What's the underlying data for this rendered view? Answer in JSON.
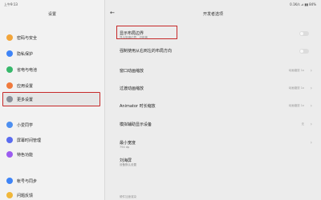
{
  "status": {
    "time": "上午9:13",
    "right": "0.1K/s ⊿ ▮▮ 84%"
  },
  "colors": {
    "highlight_border": "#c62828",
    "toggle_off": "#dcdcdc"
  },
  "left": {
    "title": "设置",
    "items": [
      {
        "label": "密码与安全",
        "icon": "lock-icon",
        "color": "#f2a53a"
      },
      {
        "label": "隐私保护",
        "icon": "privacy-icon",
        "color": "#3e84f7"
      },
      {
        "label": "省电与电池",
        "icon": "battery-icon",
        "color": "#37b86b"
      },
      {
        "label": "应用设置",
        "icon": "apps-icon",
        "color": "#f07a3c"
      },
      {
        "label": "更多设置",
        "icon": "more-settings-icon",
        "color": "#8b8f98",
        "selected": true
      },
      {
        "label": "小爱同学",
        "icon": "xiaoai-icon",
        "color": "#4d8ff0"
      },
      {
        "label": "屏幕时间管理",
        "icon": "screen-time-icon",
        "color": "#5a6cf0"
      },
      {
        "label": "特色功能",
        "icon": "features-icon",
        "color": "#9c5cf0"
      },
      {
        "label": "帐号与同步",
        "icon": "account-icon",
        "color": "#3e84f7"
      },
      {
        "label": "问题反馈",
        "icon": "feedback-icon",
        "color": "#f0b73a"
      }
    ]
  },
  "right": {
    "title": "开发者选项",
    "items": [
      {
        "title": "显示布局边界",
        "subtitle": "显示剪辑边界、边距等",
        "type": "toggle"
      },
      {
        "title": "强制使用从右到左的布局方向",
        "subtitle": "",
        "type": "toggle"
      },
      {
        "title": "窗口动画缩放",
        "subtitle": "",
        "value": "动画缩放 1x",
        "type": "select"
      },
      {
        "title": "过渡动画缩放",
        "subtitle": "",
        "value": "动画缩放 1x",
        "type": "select"
      },
      {
        "title": "Animator 时长缩放",
        "subtitle": "",
        "value": "动画缩放 1x",
        "type": "select"
      },
      {
        "title": "模拟辅助显示设备",
        "subtitle": "",
        "value": "无",
        "type": "select"
      },
      {
        "title": "最小宽度",
        "subtitle": "794 dp",
        "type": "nav"
      },
      {
        "title": "刘海屏",
        "subtitle": "设备默认设置",
        "type": "nav"
      }
    ],
    "section": "硬件加速渲染"
  }
}
